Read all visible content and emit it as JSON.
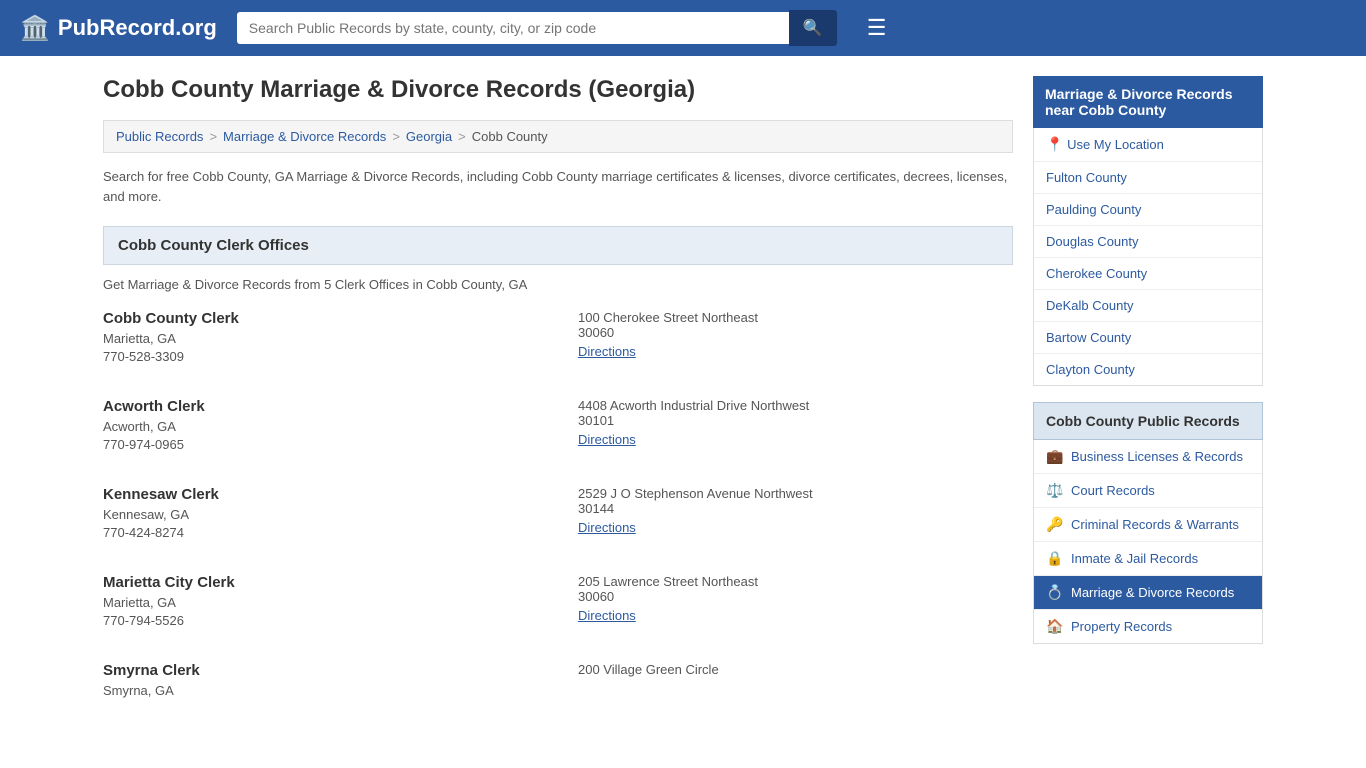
{
  "header": {
    "logo_text": "PubRecord.org",
    "search_placeholder": "Search Public Records by state, county, city, or zip code",
    "search_icon": "🔍",
    "menu_icon": "☰"
  },
  "page": {
    "title": "Cobb County Marriage & Divorce Records (Georgia)",
    "breadcrumb": [
      {
        "label": "Public Records",
        "href": "#"
      },
      {
        "label": "Marriage & Divorce Records",
        "href": "#"
      },
      {
        "label": "Georgia",
        "href": "#"
      },
      {
        "label": "Cobb County",
        "href": "#"
      }
    ],
    "description": "Search for free Cobb County, GA Marriage & Divorce Records, including Cobb County marriage certificates & licenses, divorce certificates, decrees, licenses, and more.",
    "section_header": "Cobb County Clerk Offices",
    "section_desc": "Get Marriage & Divorce Records from 5 Clerk Offices in Cobb County, GA",
    "clerks": [
      {
        "name": "Cobb County Clerk",
        "city": "Marietta, GA",
        "phone": "770-528-3309",
        "address_line1": "100 Cherokee Street Northeast",
        "address_line2": "30060",
        "directions_label": "Directions"
      },
      {
        "name": "Acworth Clerk",
        "city": "Acworth, GA",
        "phone": "770-974-0965",
        "address_line1": "4408 Acworth Industrial Drive Northwest",
        "address_line2": "30101",
        "directions_label": "Directions"
      },
      {
        "name": "Kennesaw Clerk",
        "city": "Kennesaw, GA",
        "phone": "770-424-8274",
        "address_line1": "2529 J O Stephenson Avenue Northwest",
        "address_line2": "30144",
        "directions_label": "Directions"
      },
      {
        "name": "Marietta City Clerk",
        "city": "Marietta, GA",
        "phone": "770-794-5526",
        "address_line1": "205 Lawrence Street Northeast",
        "address_line2": "30060",
        "directions_label": "Directions"
      },
      {
        "name": "Smyrna Clerk",
        "city": "Smyrna, GA",
        "phone": "",
        "address_line1": "200 Village Green Circle",
        "address_line2": "",
        "directions_label": ""
      }
    ]
  },
  "sidebar": {
    "near_header": "Marriage & Divorce Records near Cobb County",
    "use_location_label": "Use My Location",
    "near_counties": [
      {
        "label": "Fulton County",
        "href": "#"
      },
      {
        "label": "Paulding County",
        "href": "#"
      },
      {
        "label": "Douglas County",
        "href": "#"
      },
      {
        "label": "Cherokee County",
        "href": "#"
      },
      {
        "label": "DeKalb County",
        "href": "#"
      },
      {
        "label": "Bartow County",
        "href": "#"
      },
      {
        "label": "Clayton County",
        "href": "#"
      }
    ],
    "pub_records_header": "Cobb County Public Records",
    "pub_records": [
      {
        "label": "Business Licenses & Records",
        "icon": "💼",
        "href": "#",
        "active": false
      },
      {
        "label": "Court Records",
        "icon": "⚖️",
        "href": "#",
        "active": false
      },
      {
        "label": "Criminal Records & Warrants",
        "icon": "🔑",
        "href": "#",
        "active": false
      },
      {
        "label": "Inmate & Jail Records",
        "icon": "🔒",
        "href": "#",
        "active": false
      },
      {
        "label": "Marriage & Divorce Records",
        "icon": "💍",
        "href": "#",
        "active": true
      },
      {
        "label": "Property Records",
        "icon": "🏠",
        "href": "#",
        "active": false
      }
    ]
  }
}
